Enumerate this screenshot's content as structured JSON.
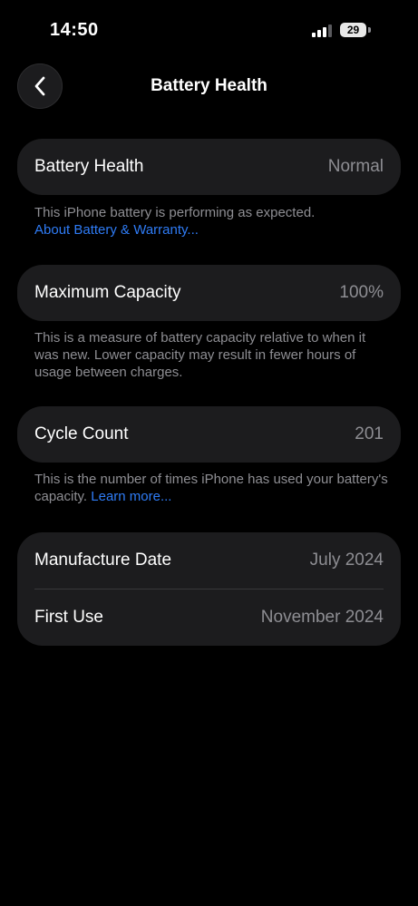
{
  "status_bar": {
    "time": "14:50",
    "battery_level": "29"
  },
  "nav": {
    "title": "Battery Health",
    "back_icon": "chevron-left-icon"
  },
  "battery_health": {
    "label": "Battery Health",
    "value": "Normal",
    "footnote": "This iPhone battery is performing as expected.",
    "link": "About Battery & Warranty..."
  },
  "maximum_capacity": {
    "label": "Maximum Capacity",
    "value": "100%",
    "footnote": "This is a measure of battery capacity relative to when it was new. Lower capacity may result in fewer hours of usage between charges."
  },
  "cycle_count": {
    "label": "Cycle Count",
    "value": "201",
    "footnote": "This is the number of times iPhone has used your battery's capacity.",
    "link": "Learn more..."
  },
  "dates": {
    "manufacture_label": "Manufacture Date",
    "manufacture_value": "July 2024",
    "first_use_label": "First Use",
    "first_use_value": "November 2024"
  },
  "colors": {
    "background": "#000000",
    "card": "#1c1c1e",
    "secondary_text": "#8e8e93",
    "link": "#2f7cf6"
  }
}
